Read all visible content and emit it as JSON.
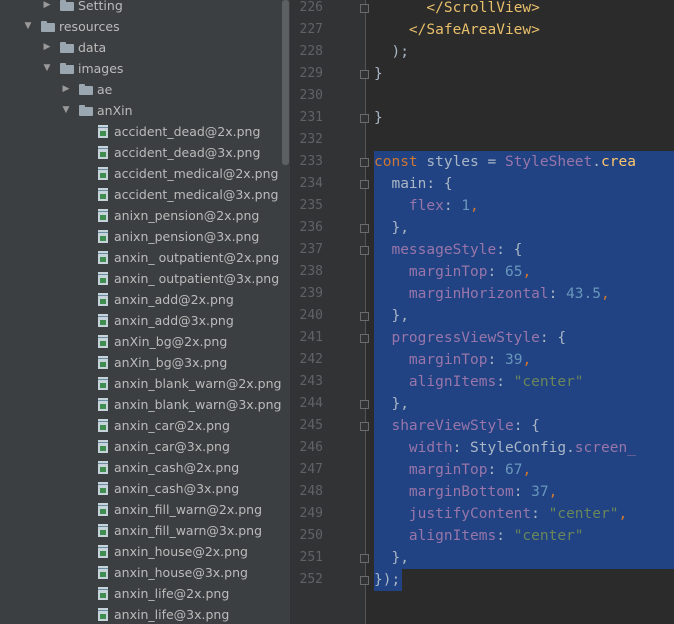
{
  "project_tree": [
    {
      "label": "Setting",
      "type": "folder",
      "expanded": false,
      "depth": 2
    },
    {
      "label": "resources",
      "type": "folder",
      "expanded": true,
      "depth": 1
    },
    {
      "label": "data",
      "type": "folder",
      "expanded": false,
      "depth": 2
    },
    {
      "label": "images",
      "type": "folder",
      "expanded": true,
      "depth": 2
    },
    {
      "label": "ae",
      "type": "folder",
      "expanded": false,
      "depth": 3
    },
    {
      "label": "anXin",
      "type": "folder",
      "expanded": true,
      "depth": 3
    },
    {
      "label": "accident_dead@2x.png",
      "type": "file",
      "depth": 4
    },
    {
      "label": "accident_dead@3x.png",
      "type": "file",
      "depth": 4
    },
    {
      "label": "accident_medical@2x.png",
      "type": "file",
      "depth": 4
    },
    {
      "label": "accident_medical@3x.png",
      "type": "file",
      "depth": 4
    },
    {
      "label": "anixn_pension@2x.png",
      "type": "file",
      "depth": 4
    },
    {
      "label": "anixn_pension@3x.png",
      "type": "file",
      "depth": 4
    },
    {
      "label": "anxin_ outpatient@2x.png",
      "type": "file",
      "depth": 4
    },
    {
      "label": "anxin_ outpatient@3x.png",
      "type": "file",
      "depth": 4
    },
    {
      "label": "anxin_add@2x.png",
      "type": "file",
      "depth": 4
    },
    {
      "label": "anxin_add@3x.png",
      "type": "file",
      "depth": 4
    },
    {
      "label": "anXin_bg@2x.png",
      "type": "file",
      "depth": 4
    },
    {
      "label": "anXin_bg@3x.png",
      "type": "file",
      "depth": 4
    },
    {
      "label": "anxin_blank_warn@2x.png",
      "type": "file",
      "depth": 4
    },
    {
      "label": "anxin_blank_warn@3x.png",
      "type": "file",
      "depth": 4
    },
    {
      "label": "anxin_car@2x.png",
      "type": "file",
      "depth": 4
    },
    {
      "label": "anxin_car@3x.png",
      "type": "file",
      "depth": 4
    },
    {
      "label": "anxin_cash@2x.png",
      "type": "file",
      "depth": 4
    },
    {
      "label": "anxin_cash@3x.png",
      "type": "file",
      "depth": 4
    },
    {
      "label": "anxin_fill_warn@2x.png",
      "type": "file",
      "depth": 4
    },
    {
      "label": "anxin_fill_warn@3x.png",
      "type": "file",
      "depth": 4
    },
    {
      "label": "anxin_house@2x.png",
      "type": "file",
      "depth": 4
    },
    {
      "label": "anxin_house@3x.png",
      "type": "file",
      "depth": 4
    },
    {
      "label": "anxin_life@2x.png",
      "type": "file",
      "depth": 4
    },
    {
      "label": "anxin_life@3x.png",
      "type": "file",
      "depth": 4
    }
  ],
  "editor": {
    "lines": [
      {
        "num": "226",
        "fold": true,
        "sel": false,
        "tokens": [
          [
            "      ",
            ""
          ],
          [
            "</ScrollView>",
            "tag"
          ]
        ]
      },
      {
        "num": "227",
        "fold": false,
        "sel": false,
        "tokens": [
          [
            "    ",
            ""
          ],
          [
            "</SafeAreaView>",
            "tag"
          ]
        ]
      },
      {
        "num": "228",
        "fold": false,
        "sel": false,
        "tokens": [
          [
            "  );",
            ""
          ]
        ]
      },
      {
        "num": "229",
        "fold": true,
        "sel": false,
        "tokens": [
          [
            "}",
            ""
          ]
        ]
      },
      {
        "num": "230",
        "fold": false,
        "sel": false,
        "tokens": [
          [
            "",
            ""
          ]
        ]
      },
      {
        "num": "231",
        "fold": true,
        "sel": false,
        "tokens": [
          [
            "}",
            ""
          ]
        ]
      },
      {
        "num": "232",
        "fold": false,
        "sel": false,
        "tokens": [
          [
            "",
            ""
          ]
        ]
      },
      {
        "num": "233",
        "fold": true,
        "sel": true,
        "tokens": [
          [
            "const",
            "kw"
          ],
          [
            " styles = ",
            ""
          ],
          [
            "StyleSheet",
            "prop"
          ],
          [
            ".",
            ""
          ],
          [
            "crea",
            "fn"
          ]
        ]
      },
      {
        "num": "234",
        "fold": true,
        "sel": true,
        "tokens": [
          [
            "  main: {",
            ""
          ]
        ]
      },
      {
        "num": "235",
        "fold": false,
        "sel": true,
        "tokens": [
          [
            "    flex",
            "prop"
          ],
          [
            ": ",
            ""
          ],
          [
            "1",
            "num"
          ],
          [
            ",",
            "punc"
          ]
        ]
      },
      {
        "num": "236",
        "fold": true,
        "sel": true,
        "tokens": [
          [
            "  },",
            ""
          ]
        ]
      },
      {
        "num": "237",
        "fold": true,
        "sel": true,
        "tokens": [
          [
            "  messageStyle",
            "prop"
          ],
          [
            ": {",
            ""
          ]
        ]
      },
      {
        "num": "238",
        "fold": false,
        "sel": true,
        "tokens": [
          [
            "    marginTop",
            "prop"
          ],
          [
            ": ",
            ""
          ],
          [
            "65",
            "num"
          ],
          [
            ",",
            "punc"
          ]
        ]
      },
      {
        "num": "239",
        "fold": false,
        "sel": true,
        "tokens": [
          [
            "    marginHorizontal",
            "prop"
          ],
          [
            ": ",
            ""
          ],
          [
            "43.5",
            "num"
          ],
          [
            ",",
            "punc"
          ]
        ]
      },
      {
        "num": "240",
        "fold": true,
        "sel": true,
        "tokens": [
          [
            "  },",
            ""
          ]
        ]
      },
      {
        "num": "241",
        "fold": true,
        "sel": true,
        "tokens": [
          [
            "  progressViewStyle",
            "prop"
          ],
          [
            ": {",
            ""
          ]
        ]
      },
      {
        "num": "242",
        "fold": false,
        "sel": true,
        "tokens": [
          [
            "    marginTop",
            "prop"
          ],
          [
            ": ",
            ""
          ],
          [
            "39",
            "num"
          ],
          [
            ",",
            "punc"
          ]
        ]
      },
      {
        "num": "243",
        "fold": false,
        "sel": true,
        "tokens": [
          [
            "    alignItems",
            "prop"
          ],
          [
            ": ",
            ""
          ],
          [
            "\"center\"",
            "str"
          ]
        ]
      },
      {
        "num": "244",
        "fold": true,
        "sel": true,
        "tokens": [
          [
            "  },",
            ""
          ]
        ]
      },
      {
        "num": "245",
        "fold": true,
        "sel": true,
        "tokens": [
          [
            "  shareViewStyle",
            "prop"
          ],
          [
            ": {",
            ""
          ]
        ]
      },
      {
        "num": "246",
        "fold": false,
        "sel": true,
        "tokens": [
          [
            "    width",
            "prop"
          ],
          [
            ": StyleConfig.",
            ""
          ],
          [
            "screen_",
            "prop"
          ]
        ]
      },
      {
        "num": "247",
        "fold": false,
        "sel": true,
        "tokens": [
          [
            "    marginTop",
            "prop"
          ],
          [
            ": ",
            ""
          ],
          [
            "67",
            "num"
          ],
          [
            ",",
            "punc"
          ]
        ]
      },
      {
        "num": "248",
        "fold": false,
        "sel": true,
        "tokens": [
          [
            "    marginBottom",
            "prop"
          ],
          [
            ": ",
            ""
          ],
          [
            "37",
            "num"
          ],
          [
            ",",
            "punc"
          ]
        ]
      },
      {
        "num": "249",
        "fold": false,
        "sel": true,
        "tokens": [
          [
            "    justifyContent",
            "prop"
          ],
          [
            ": ",
            ""
          ],
          [
            "\"center\"",
            "str"
          ],
          [
            ",",
            "punc"
          ]
        ]
      },
      {
        "num": "250",
        "fold": false,
        "sel": true,
        "tokens": [
          [
            "    alignItems",
            "prop"
          ],
          [
            ": ",
            ""
          ],
          [
            "\"center\"",
            "str"
          ]
        ]
      },
      {
        "num": "251",
        "fold": true,
        "sel": true,
        "tokens": [
          [
            "  },",
            ""
          ]
        ]
      },
      {
        "num": "252",
        "fold": true,
        "sel": true,
        "tokens": [
          [
            "});",
            ""
          ]
        ]
      }
    ]
  },
  "colors": {
    "selection": "#214283",
    "keyword": "#cc7832",
    "string": "#6a8759",
    "number": "#6897bb",
    "property": "#9876aa",
    "tag": "#e8bf6a"
  }
}
